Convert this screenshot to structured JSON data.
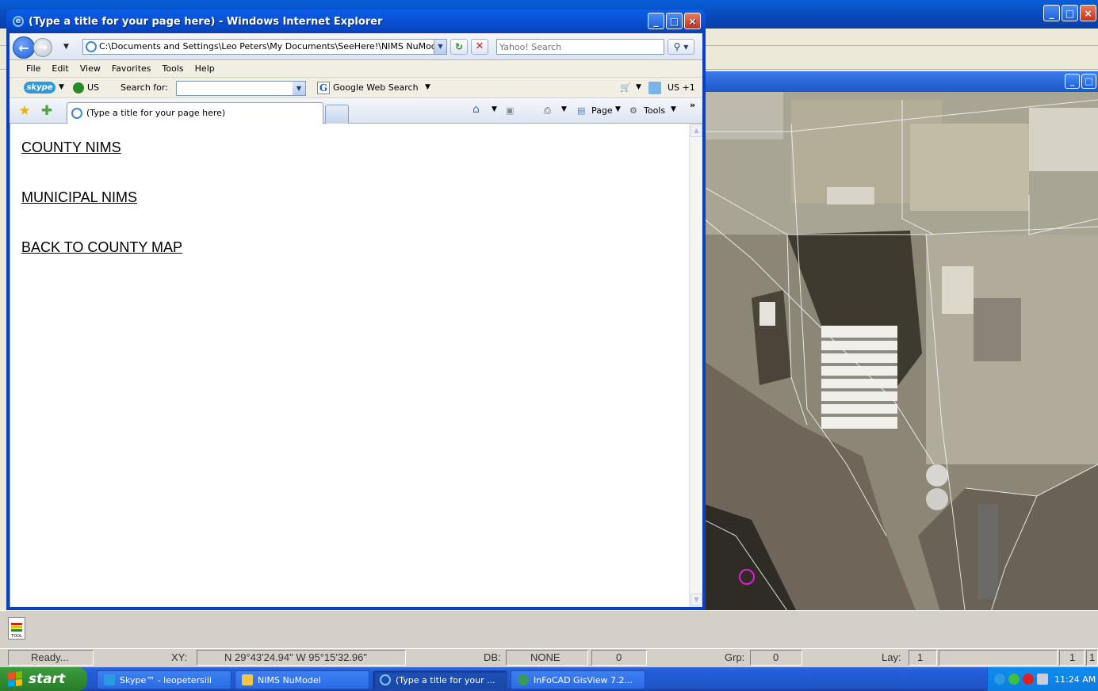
{
  "ie": {
    "title": "(Type a title for your page here) - Windows Internet Explorer",
    "address": "C:\\Documents and Settings\\Leo Peters\\My Documents\\SeeHere!\\NIMS NuModel",
    "search_placeholder": "Yahoo! Search",
    "menu": [
      "File",
      "Edit",
      "View",
      "Favorites",
      "Tools",
      "Help"
    ],
    "skype_bar": {
      "skype_label": "skype",
      "country": "US",
      "search_for": "Search for:",
      "google": "Google Web Search",
      "phone": "US +1"
    },
    "tab_title": "(Type a title for your page here)",
    "commands": {
      "page": "Page",
      "tools": "Tools"
    },
    "links": [
      "COUNTY NIMS",
      "MUNICIPAL NIMS",
      "BACK TO COUNTY MAP"
    ]
  },
  "cad_status": {
    "ready": "Ready...",
    "xy_label": "XY:",
    "xy_value": "N 29°43'24.94\"  W 95°15'32.96\"",
    "db_label": "DB:",
    "db_value": "NONE",
    "db_num": "0",
    "grp_label": "Grp:",
    "grp_value": "0",
    "lay_label": "Lay:",
    "lay_value": "1",
    "right_value": "1",
    "right_value2": "1"
  },
  "taskbar": {
    "start": "start",
    "items": [
      "Skype™ - leopetersiii",
      "NIMS NuModel",
      "(Type a title for your ...",
      "InFoCAD GisView 7.2..."
    ],
    "clock": "11:24 AM"
  },
  "colors": {
    "xp_blue": "#0a52d8",
    "start_green": "#2f8a2f",
    "map_bg": "#8a8576"
  }
}
